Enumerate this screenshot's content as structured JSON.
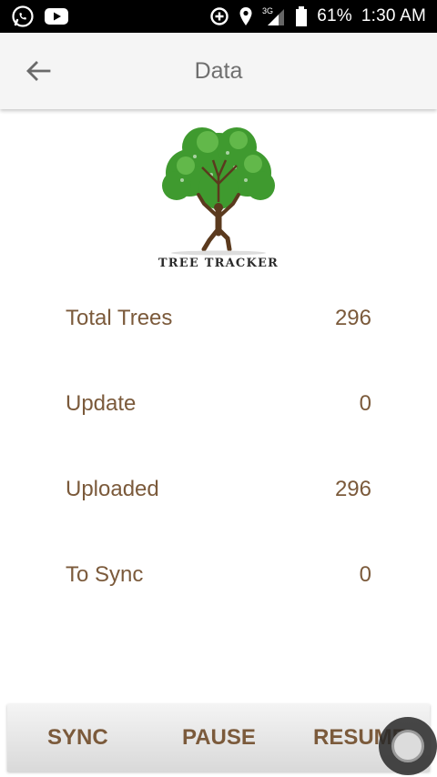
{
  "status_bar": {
    "left_icons": [
      "whatsapp-icon",
      "youtube-icon"
    ],
    "right_icons": [
      "data-saver-icon",
      "location-icon",
      "signal-3g-icon",
      "battery-icon"
    ],
    "network": "3G",
    "battery": "61%",
    "time": "1:30 AM"
  },
  "app_bar": {
    "back_icon": "arrow-left-icon",
    "title": "Data"
  },
  "logo": {
    "caption": "TREE TRACKER"
  },
  "stats": [
    {
      "label": "Total Trees",
      "value": "296"
    },
    {
      "label": "Update",
      "value": "0"
    },
    {
      "label": "Uploaded",
      "value": "296"
    },
    {
      "label": "To Sync",
      "value": "0"
    }
  ],
  "buttons": {
    "sync": "SYNC",
    "pause": "PAUSE",
    "resume": "RESUME"
  },
  "colors": {
    "accent_brown": "#7b5a3b",
    "app_bar_bg": "#f5f5f5",
    "status_bar_bg": "#000000",
    "tree_green": "#3f9a2f",
    "trunk_brown": "#5b3a1e"
  }
}
